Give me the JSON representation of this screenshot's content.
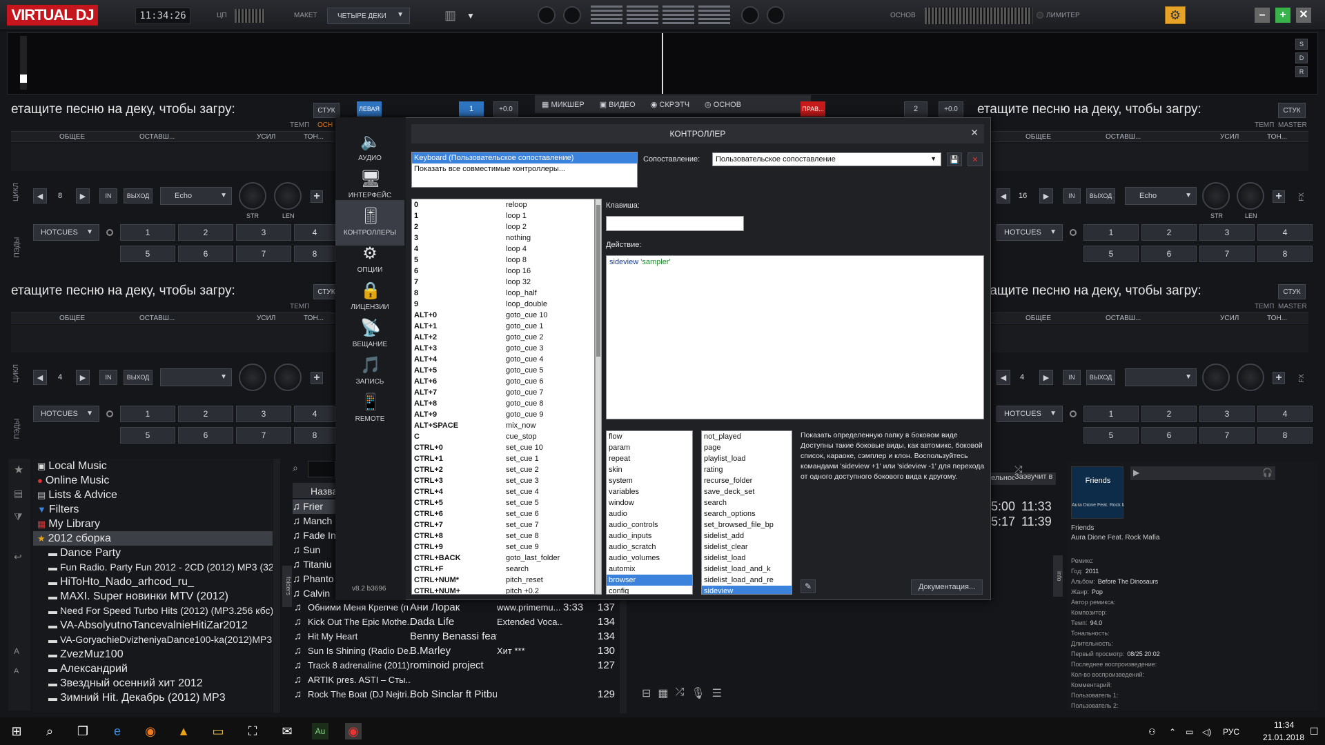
{
  "app": {
    "logo": "VIRTUAL DJ",
    "clock": "11:34:26",
    "cpu_label": "ЦП",
    "layout_label": "МАКЕТ",
    "layout_value": "ЧЕТЫРЕ ДЕКИ",
    "master_label": "ОСНОВ",
    "limiter_label": "ЛИМИТЕР"
  },
  "side_letters": [
    "S",
    "D",
    "R"
  ],
  "center_tabs": {
    "left": "ЛЕВАЯ",
    "right": "ПРАВ...",
    "deck_left": "1",
    "deck_right": "2",
    "pitch_left": "+0.0",
    "pitch_right": "+0.0",
    "mixer": "МИКШЕР",
    "video": "ВИДЕО",
    "scratch": "СКРЭТЧ",
    "master": "ОСНОВ"
  },
  "deck": {
    "title": "етащите песню на деку, чтобы загру:",
    "stuck": "СТУК",
    "tempo": "ТЕМП",
    "master": "MASTER",
    "osn": "ОСН",
    "col_general": "ОБЩЕЕ",
    "col_remain": "ОСТАВШ...",
    "col_gain": "УСИЛ",
    "col_tone": "ТОН...",
    "loop_label": "ЦИКЛ",
    "pads_label": "ПЭДЫ",
    "in": "IN",
    "out": "ВЫХОД",
    "effect": "Echo",
    "str": "STR",
    "len": "LEN",
    "fx": "FX",
    "hotcues": "HOTCUES",
    "loop_left_top": "8",
    "loop_right_top": "16",
    "loop_bottom": "4",
    "pads": [
      "1",
      "2",
      "3",
      "4",
      "5",
      "6",
      "7",
      "8"
    ]
  },
  "sidebar": [
    {
      "label": "АУДИО",
      "icon": "speaker-icon"
    },
    {
      "label": "ИНТЕРФЕЙС",
      "icon": "monitor-icon"
    },
    {
      "label": "КОНТРОЛЛЕРЫ",
      "icon": "sliders-icon"
    },
    {
      "label": "ОПЦИИ",
      "icon": "gear-icon"
    },
    {
      "label": "ЛИЦЕНЗИИ",
      "icon": "lock-icon"
    },
    {
      "label": "ВЕЩАНИЕ",
      "icon": "broadcast-icon"
    },
    {
      "label": "ЗАПИСЬ",
      "icon": "record-icon"
    },
    {
      "label": "REMOTE",
      "icon": "phone-icon"
    }
  ],
  "version": "v8.2 b3696",
  "dialog": {
    "title": "КОНТРОЛЛЕР",
    "controllers": [
      "Keyboard (Пользовательское сопоставление)",
      "Показать все совместимые контроллеры..."
    ],
    "mapping_label": "Сопоставление:",
    "mapping_value": "Пользовательское сопоставление",
    "key_label": "Клавиша:",
    "key_value": "",
    "action_label": "Действие:",
    "action_cmd": "sideview",
    "action_arg": "'sampler'",
    "doc_button": "Документация...",
    "description": "Показать определенную папку в боковом виде Доступны такие боковые виды, как автомикс, боковой список, караоке, сэмплер и клон. Воспользуйтесь командами 'sideview +1' или 'sideview -1' для перехода от одного доступного бокового вида к другому."
  },
  "key_mappings": [
    [
      "0",
      "reloop"
    ],
    [
      "1",
      "loop 1"
    ],
    [
      "2",
      "loop 2"
    ],
    [
      "3",
      "nothing"
    ],
    [
      "4",
      "loop 4"
    ],
    [
      "5",
      "loop 8"
    ],
    [
      "6",
      "loop 16"
    ],
    [
      "7",
      "loop 32"
    ],
    [
      "8",
      "loop_half"
    ],
    [
      "9",
      "loop_double"
    ],
    [
      "ALT+0",
      "goto_cue 10"
    ],
    [
      "ALT+1",
      "goto_cue 1"
    ],
    [
      "ALT+2",
      "goto_cue 2"
    ],
    [
      "ALT+3",
      "goto_cue 3"
    ],
    [
      "ALT+4",
      "goto_cue 4"
    ],
    [
      "ALT+5",
      "goto_cue 5"
    ],
    [
      "ALT+6",
      "goto_cue 6"
    ],
    [
      "ALT+7",
      "goto_cue 7"
    ],
    [
      "ALT+8",
      "goto_cue 8"
    ],
    [
      "ALT+9",
      "goto_cue 9"
    ],
    [
      "ALT+SPACE",
      "mix_now"
    ],
    [
      "C",
      "cue_stop"
    ],
    [
      "CTRL+0",
      "set_cue 10"
    ],
    [
      "CTRL+1",
      "set_cue 1"
    ],
    [
      "CTRL+2",
      "set_cue 2"
    ],
    [
      "CTRL+3",
      "set_cue 3"
    ],
    [
      "CTRL+4",
      "set_cue 4"
    ],
    [
      "CTRL+5",
      "set_cue 5"
    ],
    [
      "CTRL+6",
      "set_cue 6"
    ],
    [
      "CTRL+7",
      "set_cue 7"
    ],
    [
      "CTRL+8",
      "set_cue 8"
    ],
    [
      "CTRL+9",
      "set_cue 9"
    ],
    [
      "CTRL+BACK",
      "goto_last_folder"
    ],
    [
      "CTRL+F",
      "search"
    ],
    [
      "CTRL+NUM*",
      "pitch_reset"
    ],
    [
      "CTRL+NUM+",
      "pitch +0.2"
    ]
  ],
  "categories": [
    "flow",
    "param",
    "repeat",
    "skin",
    "system",
    "variables",
    "window",
    "audio",
    "audio_controls",
    "audio_inputs",
    "audio_scratch",
    "audio_volumes",
    "automix",
    "browser",
    "config"
  ],
  "categories_selected": "browser",
  "commands": [
    "not_played",
    "page",
    "playlist_load",
    "rating",
    "recurse_folder",
    "save_deck_set",
    "search",
    "search_options",
    "set_browsed_file_bp",
    "sidelist_add",
    "sidelist_clear",
    "sidelist_load",
    "sidelist_load_and_k",
    "sidelist_load_and_re",
    "sideview"
  ],
  "commands_selected": "sideview",
  "tree": [
    {
      "label": "Local Music",
      "icon": "computer-icon",
      "indent": 0
    },
    {
      "label": "Online Music",
      "icon": "globe-icon",
      "indent": 0
    },
    {
      "label": "Lists & Advice",
      "icon": "list-icon",
      "indent": 0
    },
    {
      "label": "Filters",
      "icon": "filter-icon",
      "indent": 0
    },
    {
      "label": "My Library",
      "icon": "library-icon",
      "indent": 0
    },
    {
      "label": "2012 сборка",
      "icon": "star-folder-icon",
      "indent": 0,
      "selected": true
    },
    {
      "label": "Dance Party",
      "icon": "folder-icon",
      "indent": 1
    },
    {
      "label": "Fun Radio. Party Fun 2012 - 2CD (2012) MP3 (320 kbps)",
      "icon": "folder-icon",
      "indent": 1,
      "small": true
    },
    {
      "label": "HiToHto_Nado_arhcod_ru_",
      "icon": "folder-icon",
      "indent": 1
    },
    {
      "label": "MAXI. Super новинки MTV (2012)",
      "icon": "folder-icon",
      "indent": 1
    },
    {
      "label": "Need For Speed Turbo Hits (2012) (MP3.256 кбс)",
      "icon": "folder-icon",
      "indent": 1,
      "small": true
    },
    {
      "label": "VA-AbsolyutnoTancevalnieHitiZar2012",
      "icon": "folder-icon",
      "indent": 1
    },
    {
      "label": "VA-GoryachieDvizheniyaDance100-ka(2012)MP3",
      "icon": "folder-icon",
      "indent": 1,
      "small": true
    },
    {
      "label": "ZvezMuz100",
      "icon": "folder-icon",
      "indent": 1
    },
    {
      "label": "Александрий",
      "icon": "folder-icon",
      "indent": 1
    },
    {
      "label": "Звездный осенний хит 2012",
      "icon": "folder-icon",
      "indent": 1
    },
    {
      "label": "Зимний Hit. Декабрь (2012) MP3",
      "icon": "folder-icon",
      "indent": 1
    }
  ],
  "song_header": {
    "title": "Назва"
  },
  "songs_partial": [
    "Frier",
    "Manch",
    "Fade In",
    "Sun",
    "Titaniu",
    "Phanto",
    "Calvin"
  ],
  "songs": [
    {
      "title": "Обними Меня Крепче (п",
      "artist": "Ани Лорак",
      "extra": "www.primemu...",
      "time": "3:33",
      "bpm": "137"
    },
    {
      "title": "Kick Out The Epic Mothe...",
      "artist": "Dada Life",
      "extra": "Extended Voca...",
      "time": "",
      "bpm": "134"
    },
    {
      "title": "Hit My Heart",
      "artist": "Benny Benassi feat. l...",
      "extra": "",
      "time": "",
      "bpm": "134"
    },
    {
      "title": "Sun Is Shining (Radio De...",
      "artist": "B.Marley",
      "extra": "Хит ***",
      "time": "",
      "bpm": "130"
    },
    {
      "title": "Track 8 adrenaline (2011)",
      "artist": "rominoid project",
      "extra": "",
      "time": "",
      "bpm": "127"
    },
    {
      "title": "ARTIK pres. ASTI – Сты...",
      "artist": "",
      "extra": "",
      "time": "",
      "bpm": ""
    },
    {
      "title": "Rock The Boat (DJ Nejtri...",
      "artist": "Bob Sinclar ft Pitbull ...",
      "extra": "",
      "time": "",
      "bpm": "129"
    }
  ],
  "right_list": {
    "col1": "ельнос",
    "col2": "Заэвучит в",
    "row1a": "5:00",
    "row1b": "11:33",
    "row2a": "5:17",
    "row2b": "11:39"
  },
  "info": {
    "cover_text": "Friends",
    "cover_sub": "Aura Dione Feat. Rock Mafia",
    "title": "Friends",
    "artist": "Aura Dione Feat. Rock Mafia",
    "fields": [
      [
        "Ремикс:",
        ""
      ],
      [
        "Год:",
        "2011"
      ],
      [
        "Альбом:",
        "Before The Dinosaurs"
      ],
      [
        "Жанр:",
        "Pop"
      ],
      [
        "Автор ремикса:",
        ""
      ],
      [
        "Композитор:",
        ""
      ],
      [
        "Темп:",
        "94.0"
      ],
      [
        "Тональность:",
        ""
      ],
      [
        "Длительность:",
        ""
      ],
      [
        "Первый просмотр:",
        "08/25 20:02"
      ],
      [
        "Последнее воспроизведение:",
        ""
      ],
      [
        "Кол-во воспроизведений:",
        ""
      ],
      [
        "Комментарий:",
        ""
      ],
      [
        "Пользователь 1:",
        ""
      ],
      [
        "Пользователь 2:",
        ""
      ]
    ],
    "side_label": "info",
    "folders_label": "folders"
  },
  "taskbar": {
    "lang": "РУС",
    "time": "11:34",
    "date": "21.01.2018"
  }
}
